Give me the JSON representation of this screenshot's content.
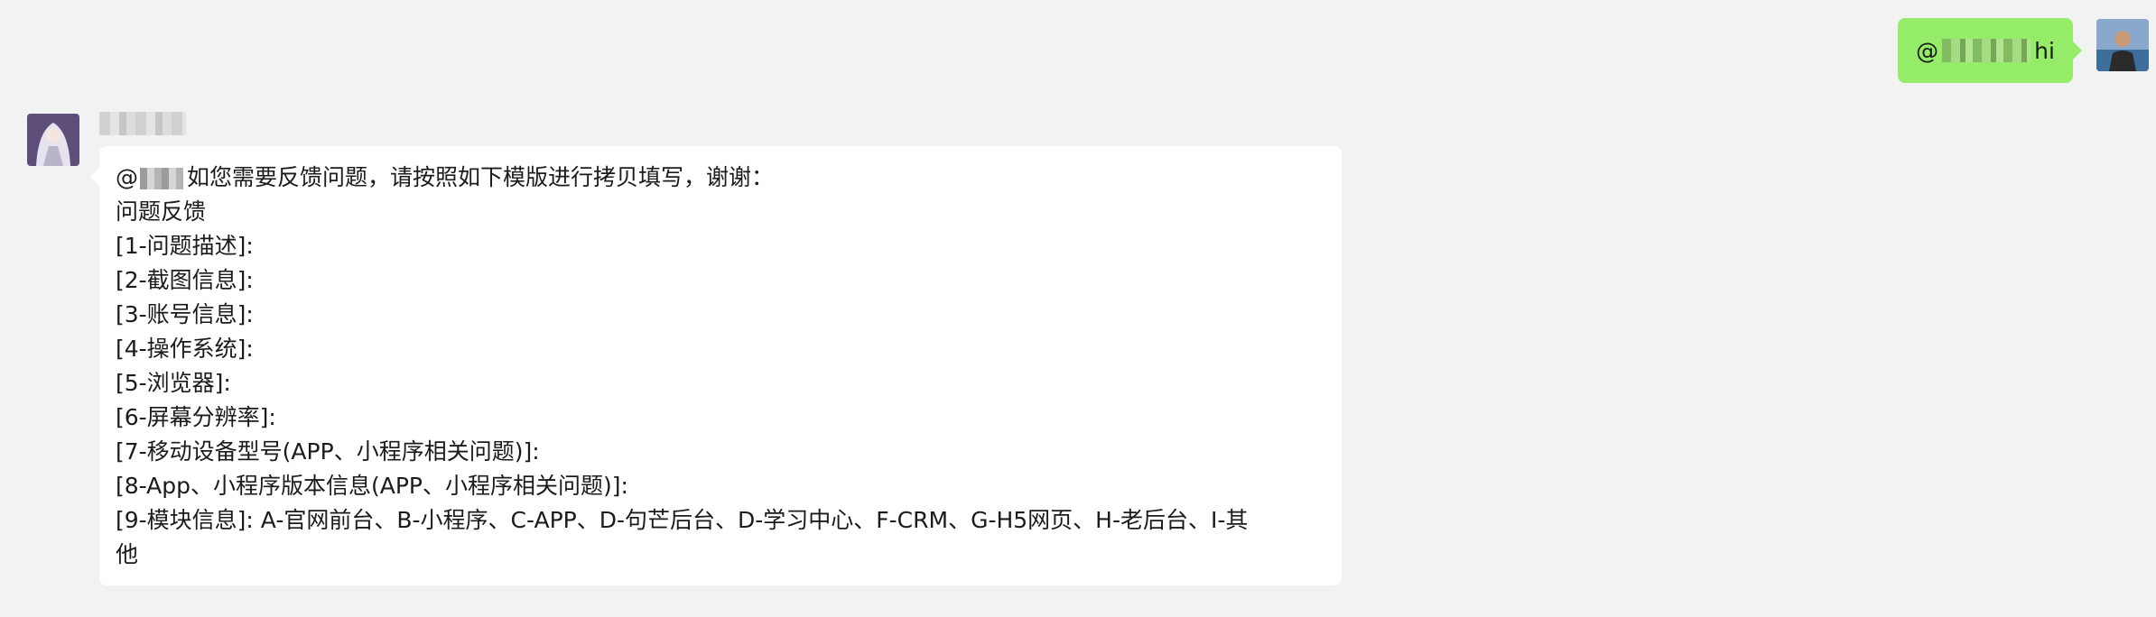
{
  "sent_message": {
    "prefix": "@",
    "suffix": "hi"
  },
  "received_message": {
    "prefix": "@",
    "intro": "如您需要反馈问题，请按照如下模版进行拷贝填写，谢谢：",
    "lines": [
      "问题反馈",
      "[1-问题描述]:",
      "[2-截图信息]:",
      "[3-账号信息]:",
      "[4-操作系统]:",
      "[5-浏览器]:",
      "[6-屏幕分辨率]:",
      "[7-移动设备型号(APP、小程序相关问题)]:",
      "[8-App、小程序版本信息(APP、小程序相关问题)]:",
      "[9-模块信息]: A-官网前台、B-小程序、C-APP、D-句芒后台、D-学习中心、F-CRM、G-H5网页、H-老后台、I-其",
      "他"
    ]
  },
  "colors": {
    "background": "#f2f2f2",
    "sent_bubble": "#95ec69",
    "received_bubble": "#ffffff",
    "text": "#1b1b1b"
  }
}
